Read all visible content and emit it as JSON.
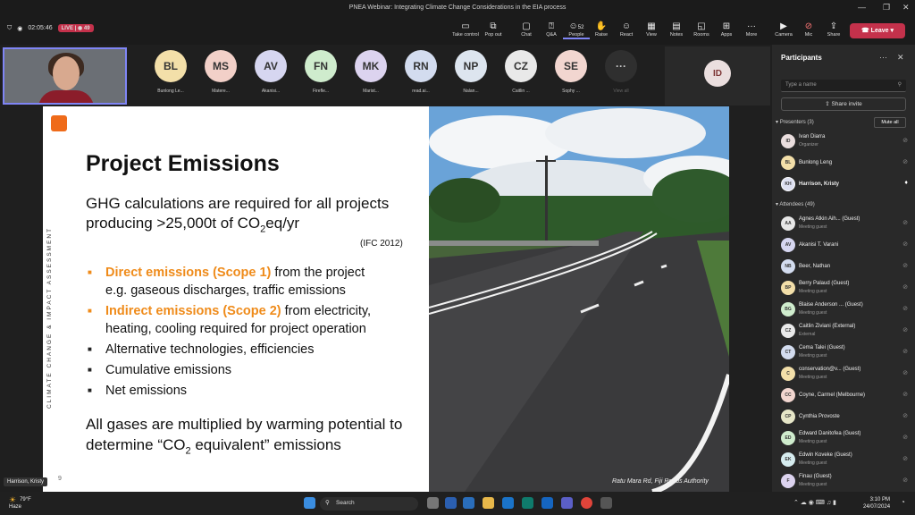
{
  "window": {
    "title": "PNEA Webinar: Integrating Climate Change Considerations in the EIA process"
  },
  "meeting": {
    "timer": "02:05:46",
    "live_label": "LIVE",
    "live_viewers": "49"
  },
  "toolbar": {
    "items": [
      {
        "label": "Take control",
        "icon": "screen-share-icon"
      },
      {
        "label": "Pop out",
        "icon": "popout-icon"
      },
      {
        "label": "Chat",
        "icon": "chat-icon"
      },
      {
        "label": "Q&A",
        "icon": "qa-icon"
      },
      {
        "label": "People",
        "icon": "people-icon",
        "count": "52"
      },
      {
        "label": "Raise",
        "icon": "raise-hand-icon"
      },
      {
        "label": "React",
        "icon": "react-icon"
      },
      {
        "label": "View",
        "icon": "view-icon"
      },
      {
        "label": "Notes",
        "icon": "notes-icon"
      },
      {
        "label": "Rooms",
        "icon": "rooms-icon"
      },
      {
        "label": "Apps",
        "icon": "apps-icon"
      },
      {
        "label": "More",
        "icon": "more-icon"
      },
      {
        "label": "Camera",
        "icon": "camera-icon"
      },
      {
        "label": "Mic",
        "icon": "mic-icon"
      },
      {
        "label": "Share",
        "icon": "share-icon"
      }
    ],
    "leave": "Leave"
  },
  "strip": [
    {
      "initials": "BL",
      "name": "Bunlong Le...",
      "color": "#f3dfa9"
    },
    {
      "initials": "MS",
      "name": "Matere...",
      "color": "#f2d0c8"
    },
    {
      "initials": "AV",
      "name": "Akanisi...",
      "color": "#d6d6f0"
    },
    {
      "initials": "FN",
      "name": "Firefle...",
      "color": "#cfeccd"
    },
    {
      "initials": "MK",
      "name": "Marist...",
      "color": "#dcd3ef"
    },
    {
      "initials": "RN",
      "name": "read.ai...",
      "color": "#d3dcef"
    },
    {
      "initials": "NP",
      "name": "Nalan...",
      "color": "#dde5ef"
    },
    {
      "initials": "CZ",
      "name": "Caitlin ...",
      "color": "#e9e9e9"
    },
    {
      "initials": "SE",
      "name": "Sophy ...",
      "color": "#f2d6d0"
    },
    {
      "initials": "···",
      "name": "View all",
      "color": "#2f2f2f"
    }
  ],
  "presenter_tile": {
    "initials": "ID"
  },
  "slide": {
    "vertical_text": "CLIMATE CHANGE & IMPACT ASSESSMENT",
    "title": "Project Emissions",
    "intro_a": "GHG calculations are required for all projects producing >25,000t of CO",
    "intro_sub": "2",
    "intro_b": "eq/yr",
    "ref": "(IFC 2012)",
    "bullets": [
      {
        "highlight": "Direct emissions (Scope 1)",
        "text": " from the project",
        "line2": "e.g. gaseous discharges, traffic emissions"
      },
      {
        "highlight": "Indirect emissions (Scope 2)",
        "text": " from electricity,",
        "line2": "heating, cooling required for project operation"
      },
      {
        "highlight": "",
        "text": "Alternative technologies, efficiencies",
        "line2": ""
      },
      {
        "highlight": "",
        "text": "Cumulative emissions",
        "line2": ""
      },
      {
        "highlight": "",
        "text": "Net emissions",
        "line2": ""
      }
    ],
    "closing_a": "All gases are multiplied by warming potential to determine “CO",
    "closing_sub": "2",
    "closing_b": " equivalent” emissions",
    "page": "9",
    "caption": "Ratu Mara Rd, Fiji Roads Authority"
  },
  "name_tag": "Harrison, Kristy",
  "panel": {
    "title": "Participants",
    "search_placeholder": "Type a name",
    "invite": "Share invite",
    "presenters_label": "Presenters (3)",
    "mute_all": "Mute all",
    "attendees_label": "Attendees (49)",
    "presenters": [
      {
        "initials": "ID",
        "name": "Ivan Diarra",
        "sub": "Organizer",
        "color": "#eadede"
      },
      {
        "initials": "BL",
        "name": "Bunlong Leng",
        "sub": "",
        "color": "#f3dfa9"
      },
      {
        "initials": "KH",
        "name": "Harrison, Kristy",
        "sub": "",
        "color": "#dde0f2"
      }
    ],
    "attendees": [
      {
        "initials": "AA",
        "name": "Agnes Atkin Aih...  (Guest)",
        "sub": "Meeting guest",
        "color": "#e6e6e6"
      },
      {
        "initials": "AV",
        "name": "Akanisi T. Varani",
        "sub": "",
        "color": "#d6d6f0"
      },
      {
        "initials": "NB",
        "name": "Beer, Nathan",
        "sub": "",
        "color": "#d3dcef"
      },
      {
        "initials": "BP",
        "name": "Berry Palaud (Guest)",
        "sub": "Meeting guest",
        "color": "#f3dfa9"
      },
      {
        "initials": "BG",
        "name": "Blaise Anderson ...  (Guest)",
        "sub": "Meeting guest",
        "color": "#cfeccd"
      },
      {
        "initials": "CZ",
        "name": "Caitlin Ziviani (External)",
        "sub": "External",
        "color": "#e9e9e9"
      },
      {
        "initials": "CT",
        "name": "Cema Talei (Guest)",
        "sub": "Meeting guest",
        "color": "#d3dcef"
      },
      {
        "initials": "C",
        "name": "conservation@v...  (Guest)",
        "sub": "Meeting guest",
        "color": "#f3dfa9"
      },
      {
        "initials": "CC",
        "name": "Coyne, Carmel (Melbourne)",
        "sub": "",
        "color": "#f2d6d0"
      },
      {
        "initials": "CP",
        "name": "Cynthia Provoste",
        "sub": "",
        "color": "#e6e6c8"
      },
      {
        "initials": "ED",
        "name": "Edward Danitofea (Guest)",
        "sub": "Meeting guest",
        "color": "#cfeccd"
      },
      {
        "initials": "EK",
        "name": "Edwin Koveke (Guest)",
        "sub": "Meeting guest",
        "color": "#d6ecef"
      },
      {
        "initials": "F",
        "name": "Finau (Guest)",
        "sub": "Meeting guest",
        "color": "#dcd3ef"
      }
    ]
  },
  "taskbar": {
    "temp": "79°F",
    "weather": "Haze",
    "search": "Search",
    "time": "3:10 PM",
    "date": "24/07/2024"
  }
}
